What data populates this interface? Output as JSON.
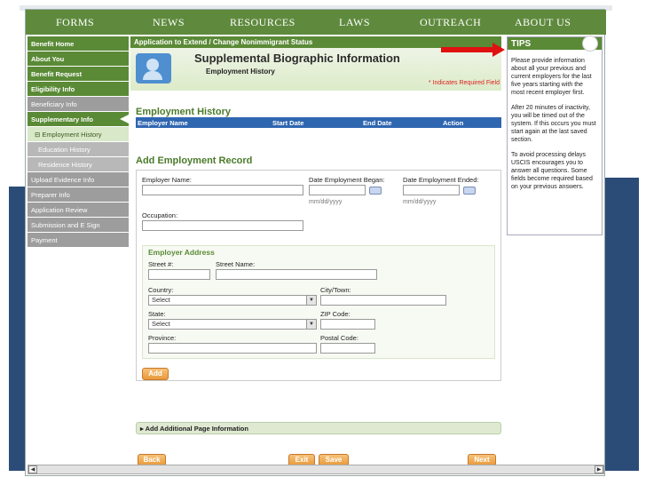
{
  "nav": {
    "items": [
      "FORMS",
      "NEWS",
      "RESOURCES",
      "LAWS",
      "OUTREACH",
      "ABOUT US"
    ]
  },
  "sidebar": {
    "items": [
      {
        "label": "Benefit Home"
      },
      {
        "label": "About You"
      },
      {
        "label": "Benefit Request"
      },
      {
        "label": "Eligibility Info"
      },
      {
        "label": "Beneficiary Info"
      },
      {
        "label": "Supplementary Info"
      },
      {
        "label": "Employment History"
      },
      {
        "label": "Education History"
      },
      {
        "label": "Residence History"
      },
      {
        "label": "Upload Evidence Info"
      },
      {
        "label": "Preparer Info"
      },
      {
        "label": "Application Review"
      },
      {
        "label": "Submission and E Sign"
      },
      {
        "label": "Payment"
      }
    ]
  },
  "main": {
    "app_title": "Application to Extend / Change Nonimmigrant Status",
    "page_title": "Supplemental Biographic Information",
    "page_subtitle": "Employment History",
    "required_note": "* Indicates Required Field",
    "history_title": "Employment History",
    "table_headers": [
      "Employer Name",
      "Start Date",
      "End Date",
      "Action"
    ],
    "add_title": "Add Employment Record",
    "form": {
      "employer_name": "Employer Name:",
      "date_began": "Date Employment Began:",
      "date_ended": "Date Employment Ended:",
      "date_hint": "mm/dd/yyyy",
      "occupation": "Occupation:",
      "address_title": "Employer Address",
      "street_no": "Street #:",
      "street_name": "Street Name:",
      "country": "Country:",
      "city": "City/Town:",
      "state": "State:",
      "zip": "ZIP Code:",
      "province": "Province:",
      "postal": "Postal Code:",
      "select_value": "Select",
      "add_button": "Add"
    },
    "additional": "Add Additional Page Information",
    "buttons": {
      "back": "Back",
      "exit": "Exit",
      "save": "Save",
      "next": "Next"
    }
  },
  "tips": {
    "title": "TIPS",
    "paragraphs": [
      "Please provide information about all your previous and current employers for the last five years starting with the most recent employer first.",
      "After 20 minutes of inactivity, you will be timed out of the system. If this occurs you must start again at the last saved section.",
      "To avoid processing delays USCIS encourages you to answer all questions. Some fields become required based on your previous answers."
    ]
  },
  "colors": {
    "nav_green": "#5f8a3e",
    "header_blue": "#2f66b0",
    "button_orange": "#e89a3a",
    "arrow_red": "#e01010"
  }
}
